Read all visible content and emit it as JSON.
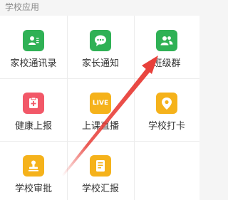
{
  "section": {
    "title": "学校应用"
  },
  "apps": [
    {
      "label": "家校通讯录",
      "icon": "contacts-book-icon",
      "color": "#2fb155"
    },
    {
      "label": "家长通知",
      "icon": "chat-bubble-icon",
      "color": "#2fb155"
    },
    {
      "label": "班级群",
      "icon": "group-people-icon",
      "color": "#2fb155"
    },
    {
      "label": "健康上报",
      "icon": "medical-kit-icon",
      "color": "#f25868"
    },
    {
      "label": "上课直播",
      "icon": "live-badge-icon",
      "icon_text": "LIVE",
      "color": "#f5b21b"
    },
    {
      "label": "学校打卡",
      "icon": "location-pin-icon",
      "color": "#f5b21b"
    },
    {
      "label": "学校审批",
      "icon": "stamp-icon",
      "color": "#f5b21b"
    },
    {
      "label": "学校汇报",
      "icon": "report-document-icon",
      "color": "#f5b21b"
    }
  ],
  "annotation": {
    "arrow_color": "#e8403a"
  }
}
